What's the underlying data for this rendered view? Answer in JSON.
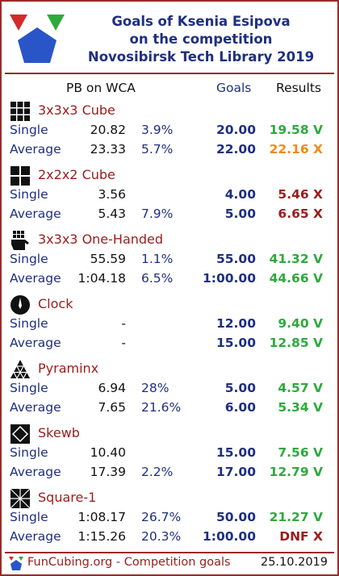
{
  "header": {
    "title_line1": "Goals of Ksenia Esipova",
    "title_line2": "on the competition",
    "title_line3": "Novosibirsk Tech Library 2019"
  },
  "columns": {
    "pb": "PB on WCA",
    "goals": "Goals",
    "results": "Results"
  },
  "colors": {
    "brand": "#9b2a2a",
    "navy": "#1f2f80",
    "success": "#2eaa3c",
    "warning": "#f08a1c",
    "fail": "#9b1c1c"
  },
  "events": [
    {
      "name": "3x3x3 Cube",
      "icon": "cube-3x3-icon",
      "single": {
        "label": "Single",
        "pb": "20.82",
        "pct": "3.9%",
        "goal": "20.00",
        "result": "19.58 V",
        "status": "success"
      },
      "average": {
        "label": "Average",
        "pb": "23.33",
        "pct": "5.7%",
        "goal": "22.00",
        "result": "22.16 X",
        "status": "warning"
      }
    },
    {
      "name": "2x2x2 Cube",
      "icon": "cube-2x2-icon",
      "single": {
        "label": "Single",
        "pb": "3.56",
        "pct": "",
        "goal": "4.00",
        "result": "5.46 X",
        "status": "fail"
      },
      "average": {
        "label": "Average",
        "pb": "5.43",
        "pct": "7.9%",
        "goal": "5.00",
        "result": "6.65 X",
        "status": "fail"
      }
    },
    {
      "name": "3x3x3 One-Handed",
      "icon": "one-handed-icon",
      "single": {
        "label": "Single",
        "pb": "55.59",
        "pct": "1.1%",
        "goal": "55.00",
        "result": "41.32 V",
        "status": "success"
      },
      "average": {
        "label": "Average",
        "pb": "1:04.18",
        "pct": "6.5%",
        "goal": "1:00.00",
        "result": "44.66 V",
        "status": "success"
      }
    },
    {
      "name": "Clock",
      "icon": "clock-icon",
      "single": {
        "label": "Single",
        "pb": "-",
        "pct": "",
        "goal": "12.00",
        "result": "9.40 V",
        "status": "success"
      },
      "average": {
        "label": "Average",
        "pb": "-",
        "pct": "",
        "goal": "15.00",
        "result": "12.85 V",
        "status": "success"
      }
    },
    {
      "name": "Pyraminx",
      "icon": "pyraminx-icon",
      "single": {
        "label": "Single",
        "pb": "6.94",
        "pct": "28%",
        "goal": "5.00",
        "result": "4.57 V",
        "status": "success"
      },
      "average": {
        "label": "Average",
        "pb": "7.65",
        "pct": "21.6%",
        "goal": "6.00",
        "result": "5.34 V",
        "status": "success"
      }
    },
    {
      "name": "Skewb",
      "icon": "skewb-icon",
      "single": {
        "label": "Single",
        "pb": "10.40",
        "pct": "",
        "goal": "15.00",
        "result": "7.56 V",
        "status": "success"
      },
      "average": {
        "label": "Average",
        "pb": "17.39",
        "pct": "2.2%",
        "goal": "17.00",
        "result": "12.79 V",
        "status": "success"
      }
    },
    {
      "name": "Square-1",
      "icon": "square-1-icon",
      "single": {
        "label": "Single",
        "pb": "1:08.17",
        "pct": "26.7%",
        "goal": "50.00",
        "result": "21.27 V",
        "status": "success"
      },
      "average": {
        "label": "Average",
        "pb": "1:15.26",
        "pct": "20.3%",
        "goal": "1:00.00",
        "result": "DNF X",
        "status": "fail"
      }
    }
  ],
  "footer": {
    "site": "FunCubing.org - Competition goals",
    "date": "25.10.2019"
  }
}
